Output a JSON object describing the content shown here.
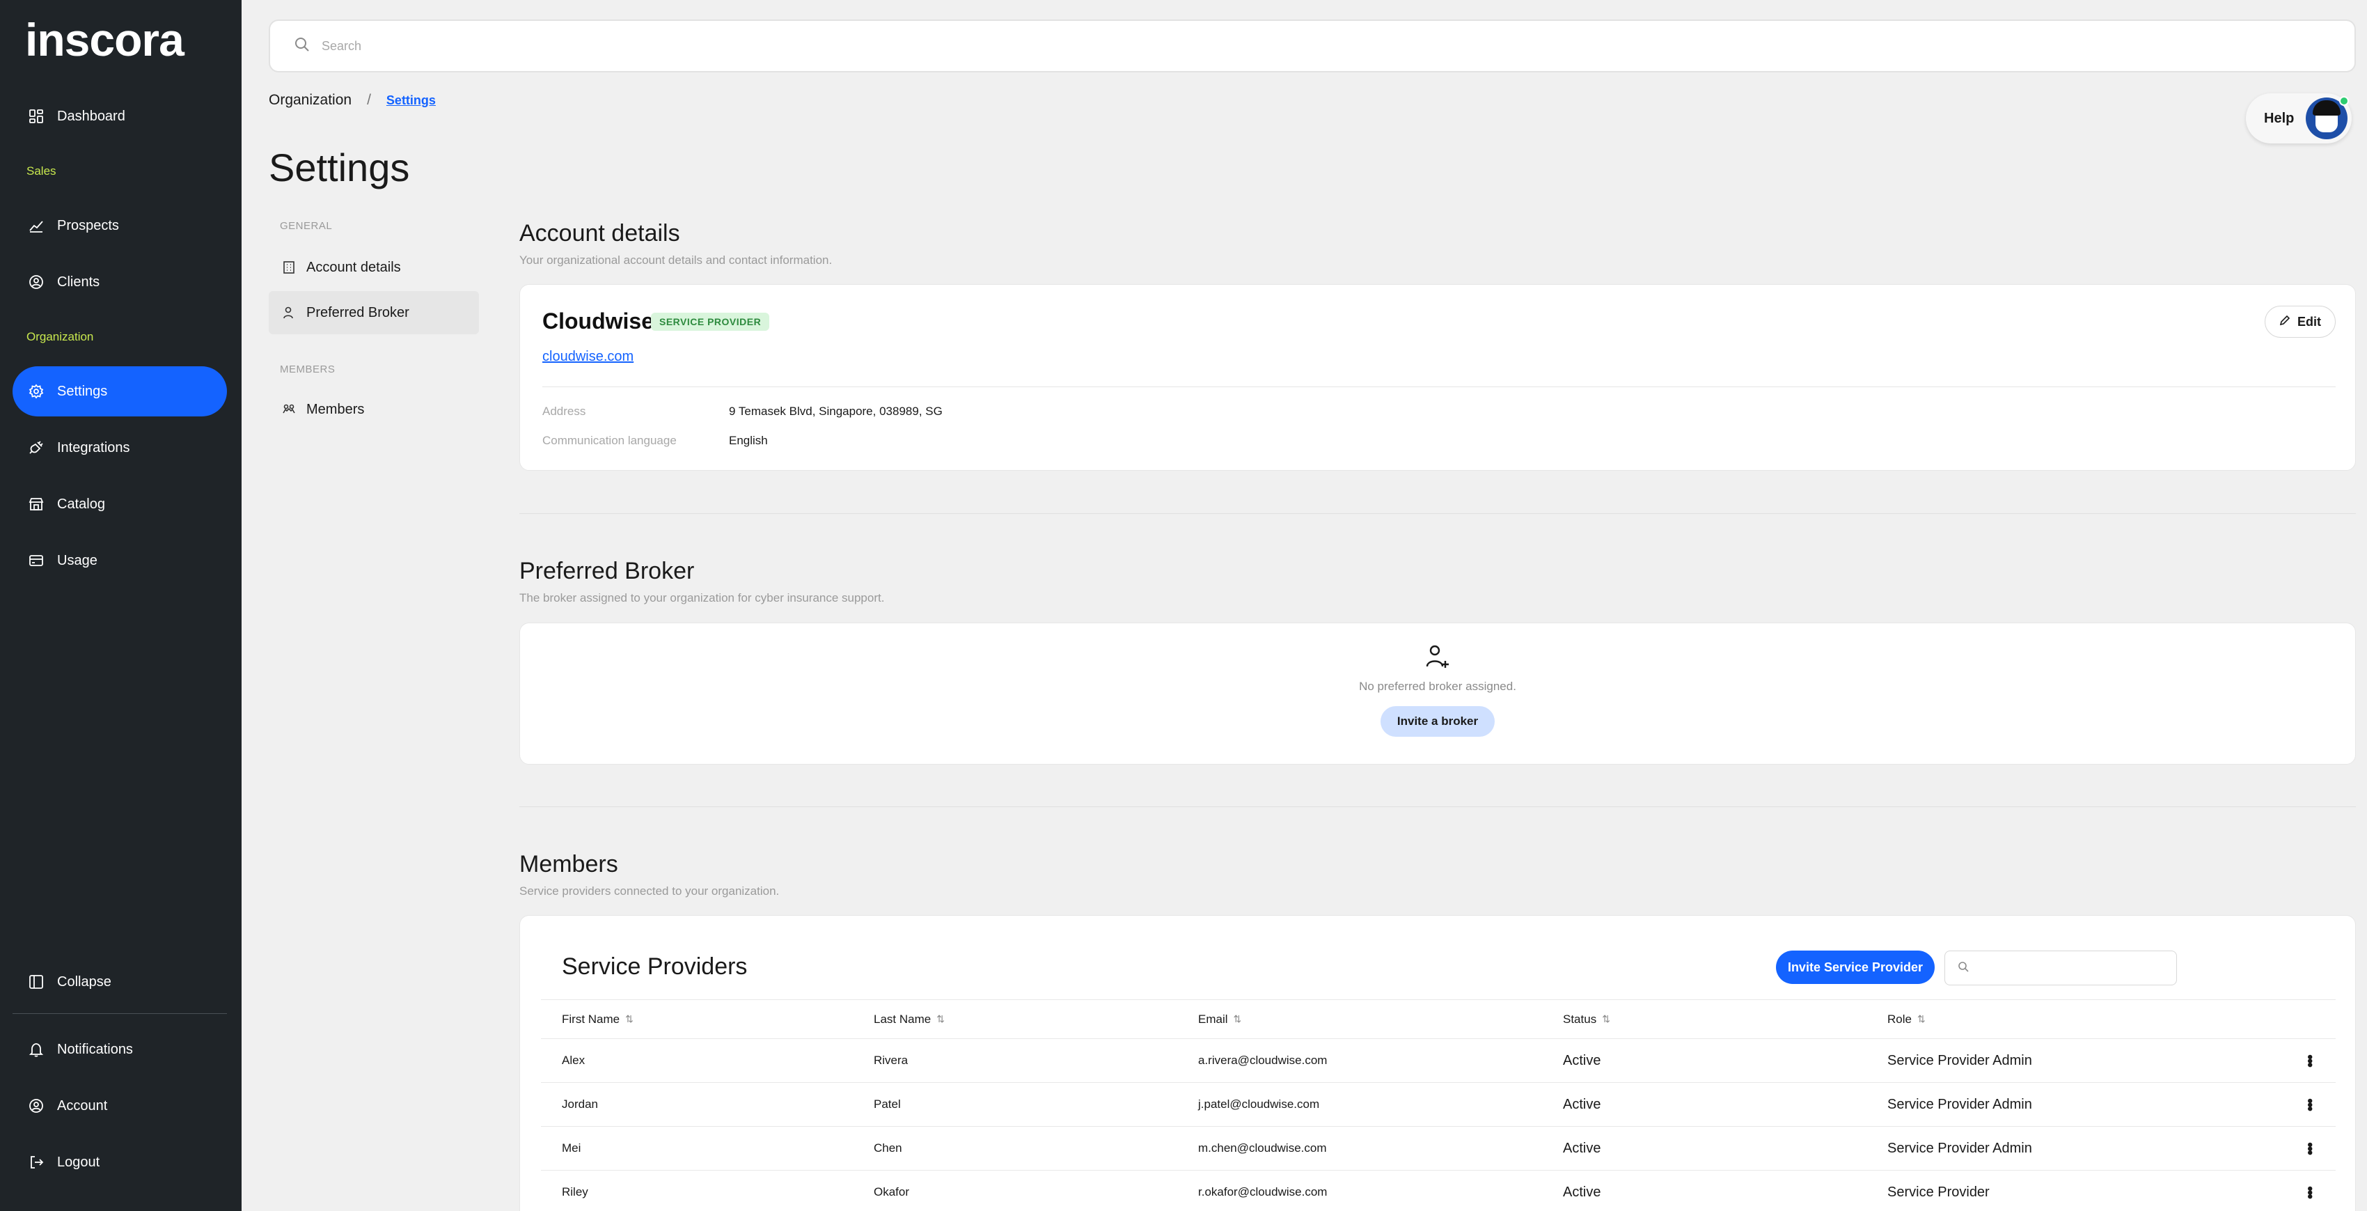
{
  "app": {
    "logo_text": "inscora"
  },
  "sidebar": {
    "top_items": [
      {
        "label": "Dashboard",
        "icon": "dashboard-icon"
      }
    ],
    "sales_label": "Sales",
    "sales_items": [
      {
        "label": "Prospects",
        "icon": "chart-line-icon"
      },
      {
        "label": "Clients",
        "icon": "user-circle-icon"
      }
    ],
    "org_label": "Organization",
    "org_items": [
      {
        "label": "Settings",
        "icon": "gear-icon",
        "active": true
      },
      {
        "label": "Integrations",
        "icon": "plug-icon"
      },
      {
        "label": "Catalog",
        "icon": "store-icon"
      },
      {
        "label": "Usage",
        "icon": "credit-card-icon"
      }
    ],
    "bottom_items": [
      {
        "label": "Collapse",
        "icon": "sidebar-collapse-icon"
      },
      {
        "label": "Notifications",
        "icon": "bell-icon"
      },
      {
        "label": "Account",
        "icon": "user-circle-icon"
      },
      {
        "label": "Logout",
        "icon": "logout-icon"
      }
    ]
  },
  "search": {
    "placeholder": "Search"
  },
  "breadcrumb": {
    "parent": "Organization",
    "separator": "/",
    "current": "Settings"
  },
  "page": {
    "title": "Settings"
  },
  "help": {
    "label": "Help"
  },
  "subnav": {
    "general_label": "GENERAL",
    "general_items": [
      {
        "label": "Account details",
        "icon": "building-icon"
      },
      {
        "label": "Preferred Broker",
        "icon": "user-icon",
        "active": true
      }
    ],
    "members_label": "MEMBERS",
    "members_items": [
      {
        "label": "Members",
        "icon": "users-icon"
      }
    ]
  },
  "account_details": {
    "title": "Account details",
    "subtitle": "Your organizational account details and contact information.",
    "name": "Cloudwise",
    "badge": "SERVICE PROVIDER",
    "website": "cloudwise.com",
    "edit_label": "Edit",
    "fields": [
      {
        "label": "Address",
        "value": "9 Temasek Blvd, Singapore, 038989, SG"
      },
      {
        "label": "Communication language",
        "value": "English"
      }
    ]
  },
  "preferred_broker": {
    "title": "Preferred Broker",
    "subtitle": "The broker assigned to your organization for cyber insurance support.",
    "empty_text": "No preferred broker assigned.",
    "invite_label": "Invite a broker"
  },
  "members": {
    "title": "Members",
    "subtitle": "Service providers connected to your organization.",
    "table_title": "Service Providers",
    "invite_label": "Invite Service Provider",
    "search_placeholder": "",
    "columns": [
      "First Name",
      "Last Name",
      "Email",
      "Status",
      "Role"
    ],
    "rows": [
      {
        "first": "Alex",
        "last": "Rivera",
        "email": "a.rivera@cloudwise.com",
        "status": "Active",
        "role": "Service Provider Admin"
      },
      {
        "first": "Jordan",
        "last": "Patel",
        "email": "j.patel@cloudwise.com",
        "status": "Active",
        "role": "Service Provider Admin"
      },
      {
        "first": "Mei",
        "last": "Chen",
        "email": "m.chen@cloudwise.com",
        "status": "Active",
        "role": "Service Provider Admin"
      },
      {
        "first": "Riley",
        "last": "Okafor",
        "email": "r.okafor@cloudwise.com",
        "status": "Active",
        "role": "Service Provider"
      }
    ]
  },
  "colors": {
    "sidebar_bg": "#1f2428",
    "accent": "#1463ff",
    "section_label": "#c8e84e",
    "badge_bg": "#d9f5dc",
    "badge_text": "#2d8a3e"
  }
}
